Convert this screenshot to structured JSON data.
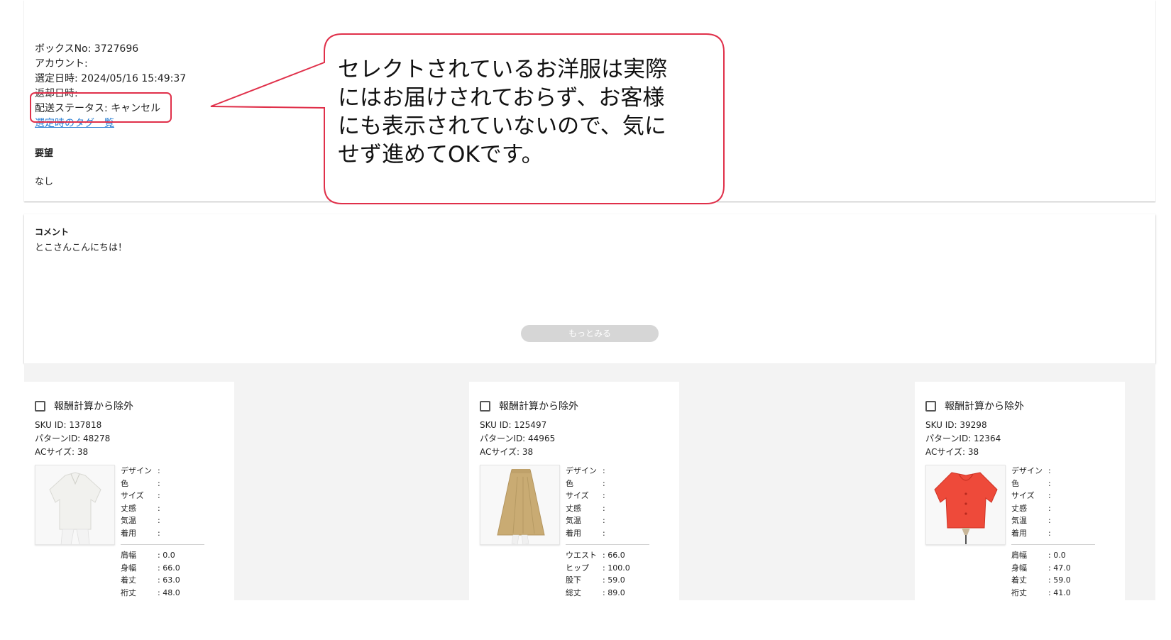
{
  "box": {
    "box_no": "ボックスNo: 3727696",
    "account": "アカウント:",
    "selected_at": "選定日時: 2024/05/16 15:49:37",
    "returned_at": "返却日時:",
    "delivery_status": "配送ステータス: キャンセル",
    "tag_list_link": "選定時のタグ一覧",
    "request_title": "要望",
    "request_value": "なし"
  },
  "callout": {
    "lines": [
      "セレクトされているお洋服は実際",
      "にはお届けされておらず、お客様",
      "にも表示されていないので、気に",
      "せず進めてOKです。"
    ],
    "border_color": "#e0304a"
  },
  "comment": {
    "title": "コメント",
    "body": "とこさんこんにちは！",
    "more_label": "もっとみる"
  },
  "items": [
    {
      "exclude_label": "報酬計算から除外",
      "sku": "SKU ID: 137818",
      "pattern": "パターンID: 48278",
      "ac_size": "ACサイズ: 38",
      "image": "white-blouse",
      "attrs": [
        {
          "k": "デザイン",
          "v": ":"
        },
        {
          "k": "色",
          "v": ":"
        },
        {
          "k": "サイズ",
          "v": ":"
        },
        {
          "k": "丈感",
          "v": ":"
        },
        {
          "k": "気温",
          "v": ":"
        },
        {
          "k": "着用",
          "v": ":"
        }
      ],
      "sizes": [
        {
          "k": "肩幅",
          "v": ": 0.0"
        },
        {
          "k": "身幅",
          "v": ": 66.0"
        },
        {
          "k": "着丈",
          "v": ": 63.0"
        },
        {
          "k": "裄丈",
          "v": ": 48.0"
        }
      ]
    },
    {
      "exclude_label": "報酬計算から除外",
      "sku": "SKU ID: 125497",
      "pattern": "パターンID: 44965",
      "ac_size": "ACサイズ: 38",
      "image": "beige-skirt",
      "attrs": [
        {
          "k": "デザイン",
          "v": ":"
        },
        {
          "k": "色",
          "v": ":"
        },
        {
          "k": "サイズ",
          "v": ":"
        },
        {
          "k": "丈感",
          "v": ":"
        },
        {
          "k": "気温",
          "v": ":"
        },
        {
          "k": "着用",
          "v": ":"
        }
      ],
      "sizes": [
        {
          "k": "ウエスト",
          "v": ": 66.0"
        },
        {
          "k": "ヒップ",
          "v": ": 100.0"
        },
        {
          "k": "股下",
          "v": ": 59.0"
        },
        {
          "k": "総丈",
          "v": ": 89.0"
        }
      ]
    },
    {
      "exclude_label": "報酬計算から除外",
      "sku": "SKU ID: 39298",
      "pattern": "パターンID: 12364",
      "ac_size": "ACサイズ: 38",
      "image": "red-top",
      "attrs": [
        {
          "k": "デザイン",
          "v": ":"
        },
        {
          "k": "色",
          "v": ":"
        },
        {
          "k": "サイズ",
          "v": ":"
        },
        {
          "k": "丈感",
          "v": ":"
        },
        {
          "k": "気温",
          "v": ":"
        },
        {
          "k": "着用",
          "v": ":"
        }
      ],
      "sizes": [
        {
          "k": "肩幅",
          "v": ": 0.0"
        },
        {
          "k": "身幅",
          "v": ": 47.0"
        },
        {
          "k": "着丈",
          "v": ": 59.0"
        },
        {
          "k": "裄丈",
          "v": ": 41.0"
        }
      ]
    }
  ]
}
